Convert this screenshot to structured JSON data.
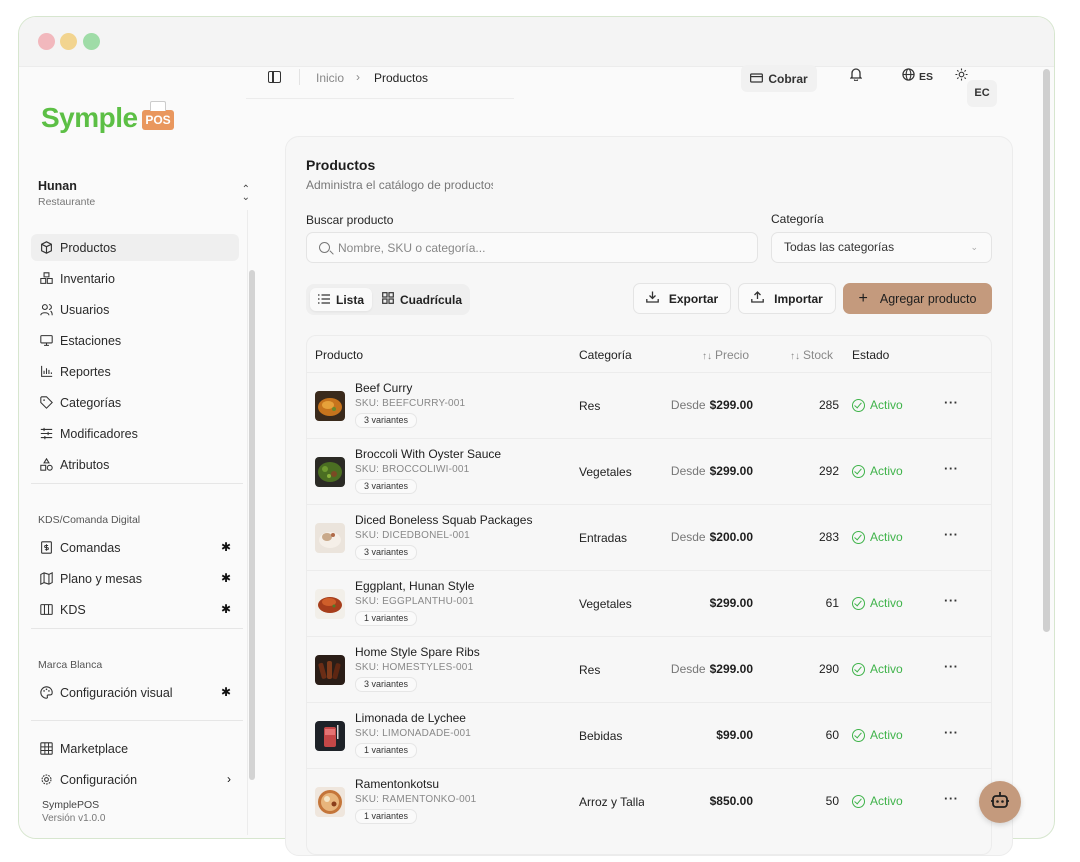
{
  "window": {
    "title": ""
  },
  "brand": {
    "name": "Symple",
    "badge": "POS",
    "accent": "#5cbf45",
    "primary": "#c49a7d"
  },
  "workspace": {
    "name": "Hunan",
    "type": "Restaurante"
  },
  "nav": {
    "main": [
      {
        "label": "Productos",
        "icon": "box-icon",
        "active": true
      },
      {
        "label": "Inventario",
        "icon": "boxes-icon"
      },
      {
        "label": "Usuarios",
        "icon": "users-icon"
      },
      {
        "label": "Estaciones",
        "icon": "monitor-icon"
      },
      {
        "label": "Reportes",
        "icon": "chart-icon"
      },
      {
        "label": "Categorías",
        "icon": "tag-icon"
      },
      {
        "label": "Modificadores",
        "icon": "sliders-icon"
      },
      {
        "label": "Atributos",
        "icon": "shapes-icon"
      }
    ],
    "kds_section": "KDS/Comanda Digital",
    "kds": [
      {
        "label": "Comandas",
        "icon": "receipt-icon"
      },
      {
        "label": "Plano y mesas",
        "icon": "map-icon"
      },
      {
        "label": "KDS",
        "icon": "columns-icon"
      }
    ],
    "brand_section": "Marca Blanca",
    "brand_items": [
      {
        "label": "Configuración visual",
        "icon": "palette-icon"
      }
    ],
    "bottom": [
      {
        "label": "Marketplace",
        "icon": "grid-icon"
      },
      {
        "label": "Configuración",
        "icon": "settings-icon"
      }
    ],
    "plugin_glyph": "✱"
  },
  "footer": {
    "app": "SymplePOS",
    "version": "Versión v1.0.0"
  },
  "topbar": {
    "breadcrumb_home": "Inicio",
    "breadcrumb_sep": "›",
    "breadcrumb_current": "Productos",
    "cobrar_label": "Cobrar",
    "language": "ES",
    "avatar": "EC"
  },
  "page": {
    "title": "Productos",
    "subtitle": "Administra el catálogo de productos",
    "search_label": "Buscar producto",
    "search_placeholder": "Nombre, SKU o categoría...",
    "category_label": "Categoría",
    "category_value": "Todas las categorías",
    "view_list": "Lista",
    "view_grid": "Cuadrícula",
    "export": "Exportar",
    "import": "Importar",
    "add": "Agregar producto"
  },
  "table": {
    "headers": {
      "product": "Producto",
      "category": "Categoría",
      "price": "Precio",
      "stock": "Stock",
      "status": "Estado"
    },
    "sort_glyph": "↑↓",
    "rows": [
      {
        "name": "Beef Curry",
        "sku": "SKU: BEEFCURRY-001",
        "variants": "3 variantes",
        "category": "Res",
        "price_prefix": "Desde",
        "price": "$299.00",
        "stock": "285",
        "status": "Activo"
      },
      {
        "name": "Broccoli With Oyster Sauce",
        "sku": "SKU: BROCCOLIWI-001",
        "variants": "3 variantes",
        "category": "Vegetales",
        "price_prefix": "Desde",
        "price": "$299.00",
        "stock": "292",
        "status": "Activo"
      },
      {
        "name": "Diced Boneless Squab Packages",
        "sku": "SKU: DICEDBONEL-001",
        "variants": "3 variantes",
        "category": "Entradas",
        "price_prefix": "Desde",
        "price": "$200.00",
        "stock": "283",
        "status": "Activo"
      },
      {
        "name": "Eggplant, Hunan Style",
        "sku": "SKU: EGGPLANTHU-001",
        "variants": "1 variantes",
        "category": "Vegetales",
        "price_prefix": "",
        "price": "$299.00",
        "stock": "61",
        "status": "Activo"
      },
      {
        "name": "Home Style Spare Ribs",
        "sku": "SKU: HOMESTYLES-001",
        "variants": "3 variantes",
        "category": "Res",
        "price_prefix": "Desde",
        "price": "$299.00",
        "stock": "290",
        "status": "Activo"
      },
      {
        "name": "Limonada de Lychee",
        "sku": "SKU: LIMONADADE-001",
        "variants": "1 variantes",
        "category": "Bebidas",
        "price_prefix": "",
        "price": "$99.00",
        "stock": "60",
        "status": "Activo"
      },
      {
        "name": "Ramentonkotsu",
        "sku": "SKU: RAMENTONKO-001",
        "variants": "1 variantes",
        "category": "Arroz y Tallarines",
        "price_prefix": "",
        "price": "$850.00",
        "stock": "50",
        "status": "Activo"
      }
    ],
    "more_glyph": "···"
  }
}
